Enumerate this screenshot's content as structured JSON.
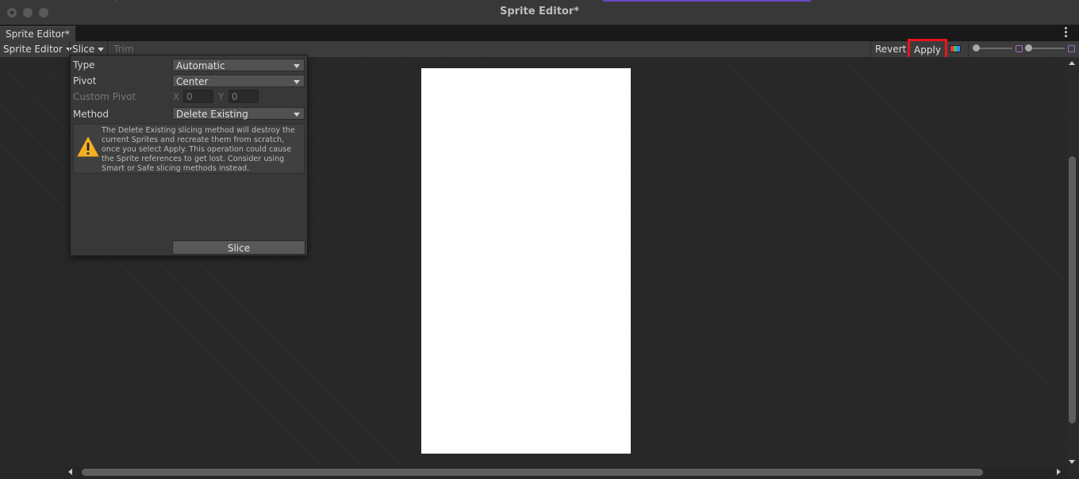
{
  "window": {
    "title": "Sprite Editor*"
  },
  "tab": {
    "label": "Sprite Editor*"
  },
  "toolbar": {
    "mode_label": "Sprite Editor",
    "slice_label": "Slice",
    "trim_label": "Trim",
    "revert_label": "Revert",
    "apply_label": "Apply",
    "highlight_color": "#e8141c"
  },
  "slice_popup": {
    "type_label": "Type",
    "type_value": "Automatic",
    "pivot_label": "Pivot",
    "pivot_value": "Center",
    "custom_pivot_label": "Custom Pivot",
    "x_label": "X",
    "x_value": "0",
    "y_label": "Y",
    "y_value": "0",
    "method_label": "Method",
    "method_value": "Delete Existing",
    "warning_text": "The Delete Existing slicing method will destroy the current Sprites and recreate them from scratch, once you select Apply. This operation could cause the Sprite references to get lost. Consider using Smart or Safe slicing methods instead.",
    "slice_button_label": "Slice"
  },
  "icons": [
    "warning-icon",
    "rgb-channel-icon",
    "zoom-slider",
    "mip-slider",
    "dropdown-caret-icon",
    "more-options-icon"
  ]
}
